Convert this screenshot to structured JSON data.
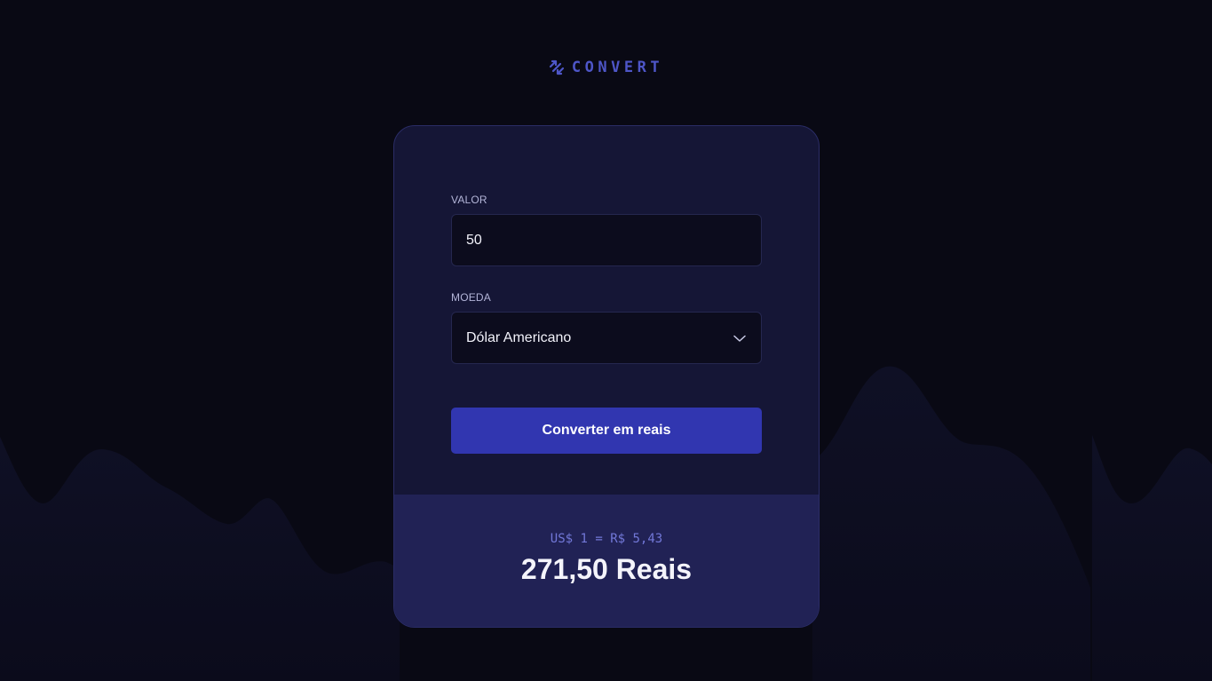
{
  "brand": {
    "name": "CONVERT",
    "icon": "convert-arrows-icon",
    "color": "#4e56c8"
  },
  "form": {
    "value_label": "VALOR",
    "value": "50",
    "currency_label": "MOEDA",
    "currency_selected": "Dólar Americano",
    "submit_label": "Converter em reais"
  },
  "result": {
    "rate": "US$ 1 = R$ 5,43",
    "total": "271,50 Reais"
  },
  "colors": {
    "background": "#090914",
    "card": "#151636",
    "result_panel": "#212255",
    "button": "#3136b0",
    "accent_text": "#7278d8"
  }
}
